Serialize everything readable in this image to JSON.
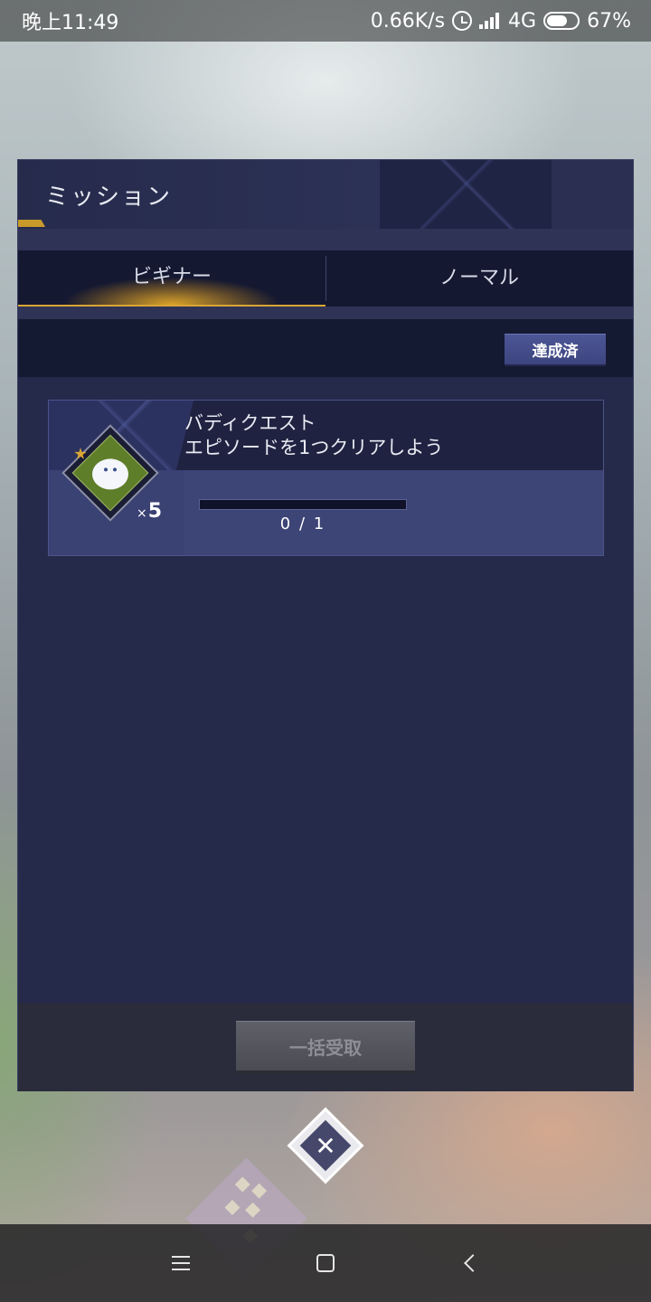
{
  "status_bar": {
    "time": "晚上11:49",
    "network_speed": "0.66K/s",
    "network_type": "4G",
    "battery_percent": "67%",
    "battery_level": 0.67,
    "icons": [
      "alarm-icon",
      "signal-icon",
      "battery-icon"
    ]
  },
  "panel": {
    "title": "ミッション",
    "tabs": [
      {
        "label": "ビギナー",
        "active": true
      },
      {
        "label": "ノーマル",
        "active": false
      }
    ],
    "completed_button_label": "達成済"
  },
  "missions": [
    {
      "name": "バディクエスト",
      "description": "エピソードを1つクリアしよう",
      "reward_quantity": "5",
      "reward_multiplier": "×",
      "progress_text": "0 / 1",
      "progress_fraction": 0
    }
  ],
  "footer": {
    "claim_all_label": "一括受取"
  },
  "colors": {
    "accent_gold": "#d9a634",
    "panel_bg": "#262a4a",
    "button_blue": "#4d5696"
  }
}
